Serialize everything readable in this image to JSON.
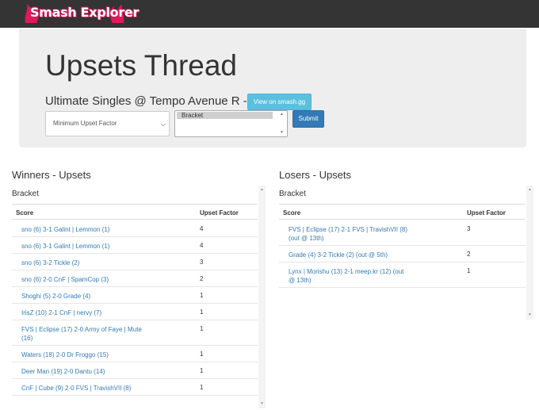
{
  "nav": {
    "logo_text": "Smash Explorer"
  },
  "header": {
    "title": "Upsets Thread",
    "event": "Ultimate Singles @ Tempo Avenue R - 20",
    "smashgg_button": "View on smash.gg",
    "upset_select": "Minimum Upset Factor",
    "phase_option": "Bracket",
    "submit": "Submit"
  },
  "columns": {
    "score": "Score",
    "factor": "Upset Factor"
  },
  "winners": {
    "title": "Winners - Upsets",
    "phase": "Bracket",
    "rows": [
      {
        "score": [
          "sno (6) 3-1 Galint | Lemmon (1)"
        ],
        "factor": "4"
      },
      {
        "score": [
          "sno (6) 3-1 Galint | Lemmon (1)"
        ],
        "factor": "4"
      },
      {
        "score": [
          "sno (6) 3-2 Tickle (2)"
        ],
        "factor": "3"
      },
      {
        "score": [
          "sno (6) 2-0 CnF | SpamCop (3)"
        ],
        "factor": "2"
      },
      {
        "score": [
          "Shoghi (5) 2-0 Grade (4)"
        ],
        "factor": "1"
      },
      {
        "score": [
          "IrisZ (10) 2-1 CnF | nervy (7)"
        ],
        "factor": "1"
      },
      {
        "score": [
          "FVS | Eclipse (17) 2-0 Army of Faye | Mute",
          "(16)"
        ],
        "factor": "1"
      },
      {
        "score": [
          "Waters (18) 2-0 Dr Froggo (15)"
        ],
        "factor": "1"
      },
      {
        "score": [
          "Deer Man (19) 2-0 Dantu (14)"
        ],
        "factor": "1"
      },
      {
        "score": [
          "CnF | Cube (9) 2-0 FVS | TravishVII (8)"
        ],
        "factor": "1"
      }
    ]
  },
  "losers": {
    "title": "Losers - Upsets",
    "phase": "Bracket",
    "rows": [
      {
        "score": [
          "FVS | Eclipse (17) 2-1 FVS | TravishVII (8)",
          "(out @ 13th)"
        ],
        "factor": "3"
      },
      {
        "score": [
          "Grade (4) 3-2 Tickle (2) (out @ 5th)"
        ],
        "factor": "2"
      },
      {
        "score": [
          "Lynx | Morishu (13) 2-1 meep.kr (12) (out",
          "@ 13th)"
        ],
        "factor": "1"
      }
    ]
  },
  "colors": {
    "navbar": "#343434",
    "link": "#337ab7",
    "info_button": "#5bc0de",
    "primary_button": "#337ab7",
    "jumbotron": "#eeeeee"
  }
}
